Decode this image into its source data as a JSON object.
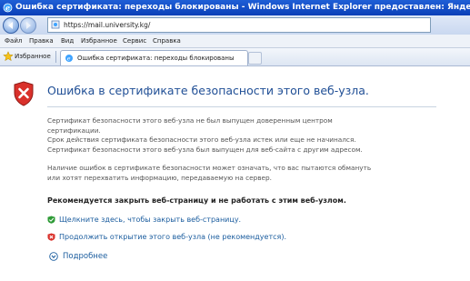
{
  "window": {
    "title": "Ошибка сертификата: переходы блокированы - Windows Internet Explorer предоставлен: Яндекс"
  },
  "address": {
    "url": "https://mail.university.kg/"
  },
  "menu": {
    "items": [
      "Файл",
      "Правка",
      "Вид",
      "Избранное",
      "Сервис",
      "Справка"
    ]
  },
  "favorites": {
    "label": "Избранное"
  },
  "tab": {
    "label": "Ошибка сертификата: переходы блокированы"
  },
  "page": {
    "heading": "Ошибка в сертификате безопасности этого веб-узла.",
    "paragraph1": [
      "Сертификат безопасности этого веб-узла не был выпущен доверенным центром",
      "сертификации.",
      "Срок действия сертификата безопасности этого веб-узла истек или еще не начинался.",
      "Сертификат безопасности этого веб-узла был выпущен для веб-сайта с другим адресом."
    ],
    "paragraph2": [
      "Наличие ошибок в сертификате безопасности может означать, что вас пытаются обмануть",
      "или хотят перехватить информацию, передаваемую на сервер."
    ],
    "recommendation": "Рекомендуется закрыть веб-страницу и не работать с этим веб-узлом.",
    "close_link": "Щелкните здесь, чтобы закрыть веб-страницу.",
    "continue_link": "Продолжить открытие этого веб-узла (не рекомендуется).",
    "more_info": "Подробнее"
  },
  "icons": {
    "ie": "ie-logo-icon",
    "back": "back-arrow-icon",
    "forward": "forward-arrow-icon",
    "error_shield": "error-shield-icon",
    "close_link": "green-check-shield-icon",
    "continue_link": "red-x-shield-icon",
    "more": "expand-circle-icon"
  },
  "colors": {
    "heading": "#1f4e95",
    "link": "#1a5c9e",
    "titlebar": "#1f5fd6"
  }
}
